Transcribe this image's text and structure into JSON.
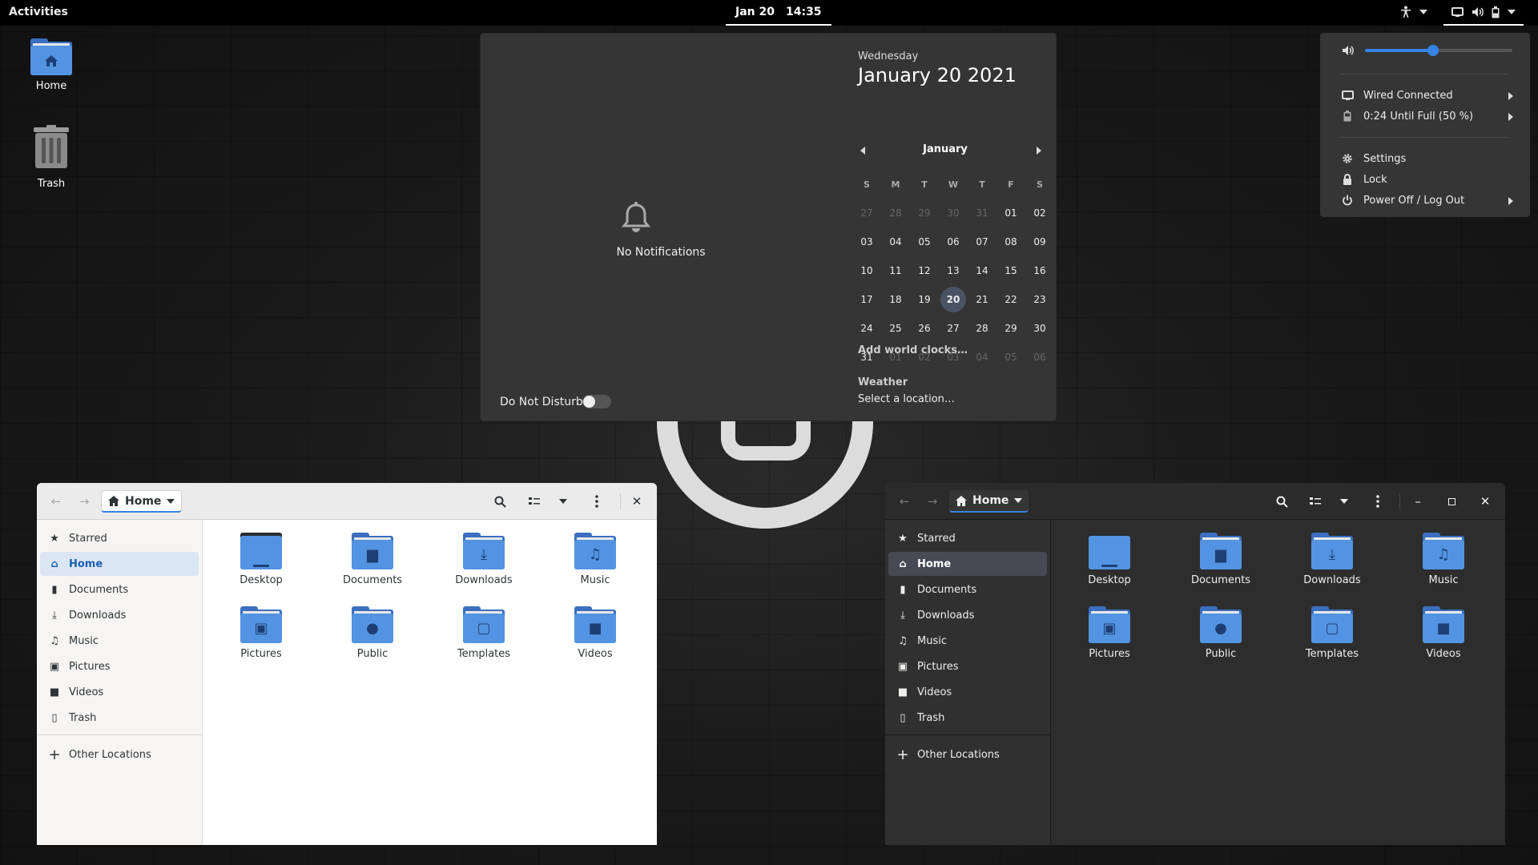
{
  "topbar": {
    "activities": "Activities",
    "date": "Jan 20",
    "time": "14:35"
  },
  "desktop": {
    "icons": [
      {
        "label": "Home",
        "icon": "home-folder-icon"
      },
      {
        "label": "Trash",
        "icon": "trash-icon"
      }
    ]
  },
  "calendar_popover": {
    "no_notifications": "No Notifications",
    "do_not_disturb": "Do Not Disturb",
    "do_not_disturb_on": false,
    "weekday": "Wednesday",
    "full_date": "January 20 2021",
    "month": "January",
    "day_headers": [
      "S",
      "M",
      "T",
      "W",
      "T",
      "F",
      "S"
    ],
    "weeks": [
      [
        "27",
        "28",
        "29",
        "30",
        "31",
        "01",
        "02"
      ],
      [
        "03",
        "04",
        "05",
        "06",
        "07",
        "08",
        "09"
      ],
      [
        "10",
        "11",
        "12",
        "13",
        "14",
        "15",
        "16"
      ],
      [
        "17",
        "18",
        "19",
        "20",
        "21",
        "22",
        "23"
      ],
      [
        "24",
        "25",
        "26",
        "27",
        "28",
        "29",
        "30"
      ],
      [
        "31",
        "01",
        "02",
        "03",
        "04",
        "05",
        "06"
      ]
    ],
    "today": "20",
    "add_world_clocks": "Add world clocks…",
    "weather_title": "Weather",
    "weather_location": "Select a location…"
  },
  "system_menu": {
    "volume_fraction": 0.46,
    "wired": "Wired Connected",
    "battery": "0:24 Until Full (50 %)",
    "settings": "Settings",
    "lock": "Lock",
    "power": "Power Off / Log Out"
  },
  "file_manager": {
    "path_label": "Home",
    "sidebar": [
      {
        "label": "Starred",
        "icon": "star-icon"
      },
      {
        "label": "Home",
        "icon": "home-icon"
      },
      {
        "label": "Documents",
        "icon": "document-icon"
      },
      {
        "label": "Downloads",
        "icon": "download-icon"
      },
      {
        "label": "Music",
        "icon": "music-icon"
      },
      {
        "label": "Pictures",
        "icon": "picture-icon"
      },
      {
        "label": "Videos",
        "icon": "video-icon"
      },
      {
        "label": "Trash",
        "icon": "trash-icon"
      }
    ],
    "other_locations": "Other Locations",
    "files": [
      {
        "name": "Desktop",
        "glyph": ""
      },
      {
        "name": "Documents",
        "glyph": "▆"
      },
      {
        "name": "Downloads",
        "glyph": "⤓"
      },
      {
        "name": "Music",
        "glyph": "♫"
      },
      {
        "name": "Pictures",
        "glyph": "▣"
      },
      {
        "name": "Public",
        "glyph": "●"
      },
      {
        "name": "Templates",
        "glyph": "▢"
      },
      {
        "name": "Videos",
        "glyph": "■"
      }
    ]
  },
  "colors": {
    "accent": "#3584e4",
    "folder_front": "#5294e2",
    "folder_back": "#3b6fc0"
  }
}
